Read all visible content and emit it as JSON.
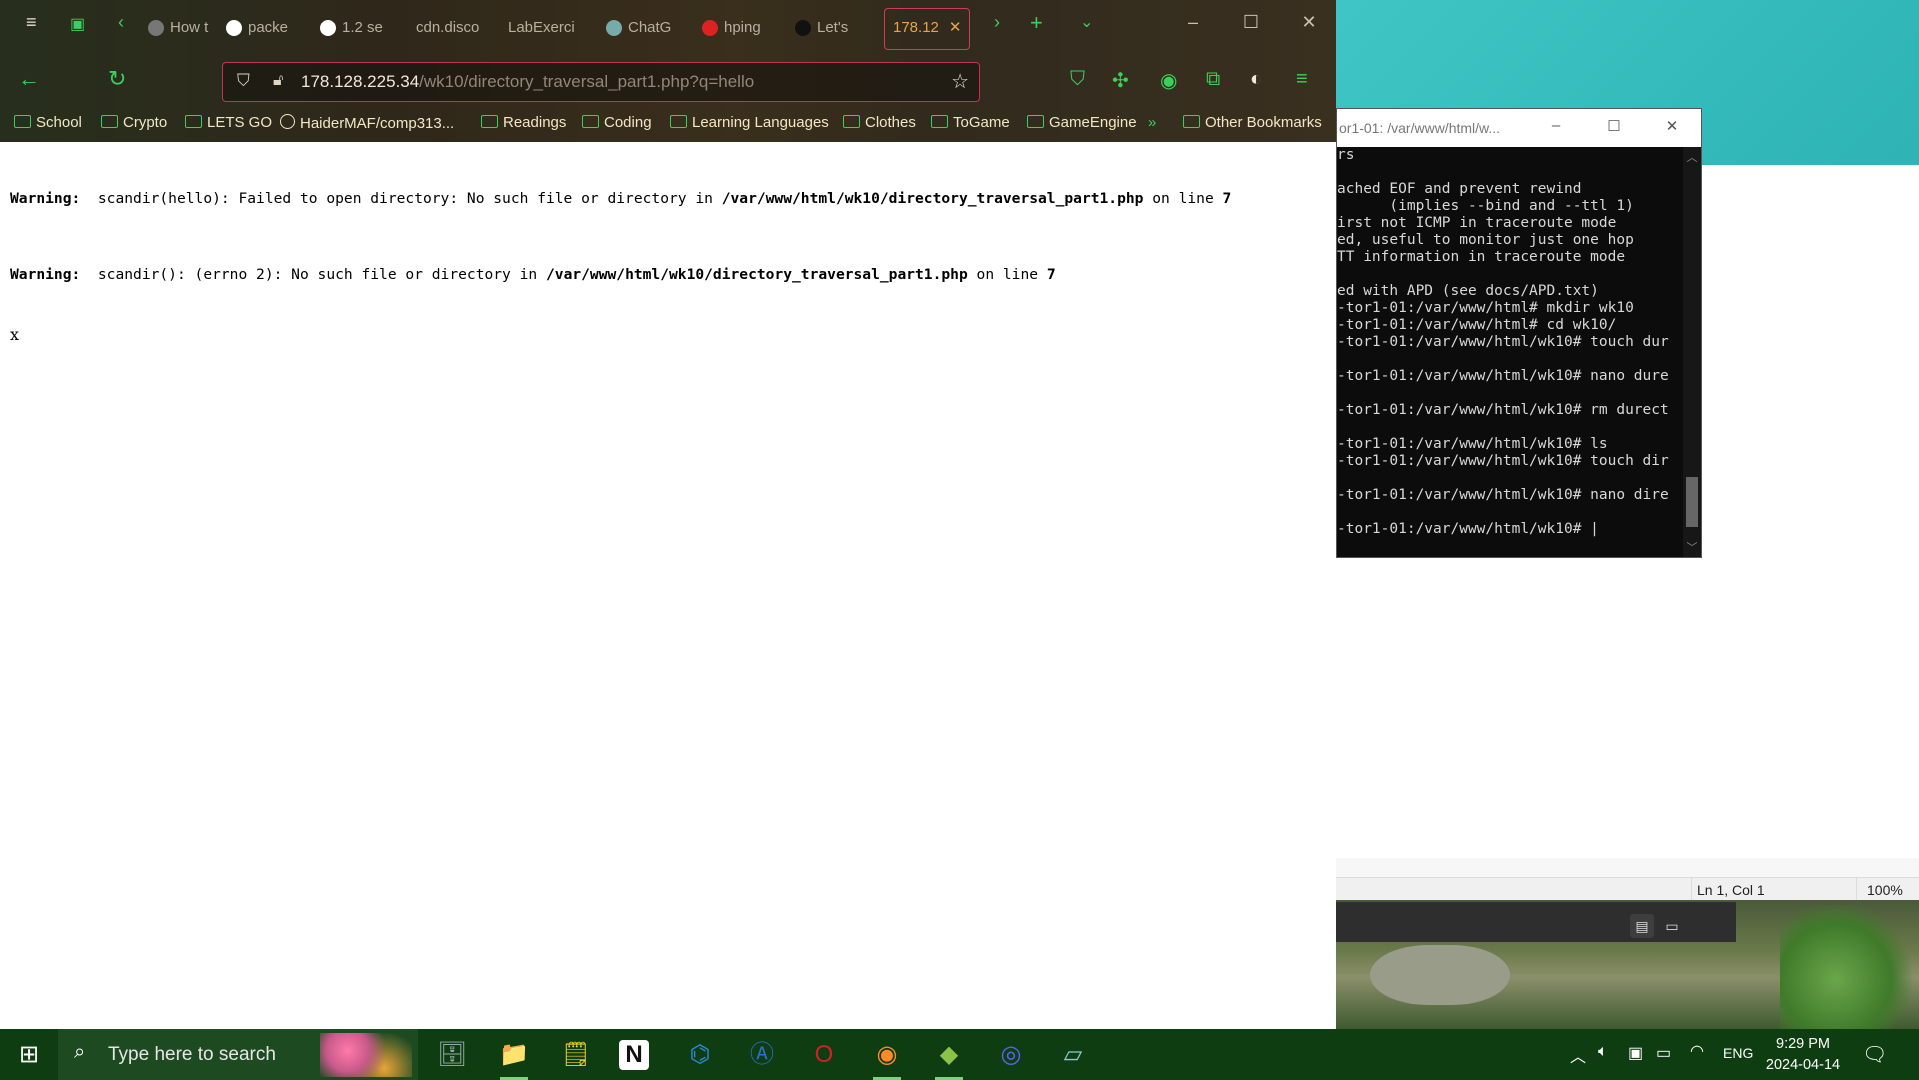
{
  "browser": {
    "tabs": [
      {
        "label": "How t",
        "fav": "#777"
      },
      {
        "label": "packe",
        "fav": "google"
      },
      {
        "label": "1.2 se",
        "fav": "google"
      },
      {
        "label": "cdn.disco",
        "fav": "none"
      },
      {
        "label": "LabExerci",
        "fav": "none"
      },
      {
        "label": "ChatG",
        "fav": "#7aa"
      },
      {
        "label": "hping",
        "fav": "#d22"
      },
      {
        "label": "Let's",
        "fav": "#111"
      },
      {
        "label": "178.12",
        "fav": "none",
        "active": true
      }
    ],
    "url_host": "178.128.225.34",
    "url_path": "/wk10/directory_traversal_part1.php?q=hello",
    "bookmarks": [
      "School",
      "Crypto",
      "LETS GO",
      "HaiderMAF/comp313...",
      "Readings",
      "Coding",
      "Learning Languages",
      "Clothes",
      "ToGame",
      "GameEngine"
    ],
    "other_bookmarks": "Other Bookmarks"
  },
  "page": {
    "warning1": {
      "label": "Warning",
      "text": "scandir(hello): Failed to open directory: No such file or directory in ",
      "file": "/var/www/html/wk10/directory_traversal_part1.php",
      "on_line": " on line ",
      "line": "7"
    },
    "warning2": {
      "label": "Warning",
      "text": "scandir(): (errno 2): No such file or directory in ",
      "file": "/var/www/html/wk10/directory_traversal_part1.php",
      "on_line": " on line ",
      "line": "7"
    },
    "output": "x"
  },
  "terminal": {
    "title": "or1-01: /var/www/html/w...",
    "lines": [
      "rs",
      "",
      "ached EOF and prevent rewind",
      "      (implies --bind and --ttl 1)",
      "irst not ICMP in traceroute mode",
      "ed, useful to monitor just one hop",
      "TT information in traceroute mode",
      "",
      "ed with APD (see docs/APD.txt)",
      "-tor1-01:/var/www/html# mkdir wk10",
      "-tor1-01:/var/www/html# cd wk10/",
      "-tor1-01:/var/www/html/wk10# touch dur",
      "",
      "-tor1-01:/var/www/html/wk10# nano dure",
      "",
      "-tor1-01:/var/www/html/wk10# rm durect",
      "",
      "-tor1-01:/var/www/html/wk10# ls",
      "-tor1-01:/var/www/html/wk10# touch dir",
      "",
      "-tor1-01:/var/www/html/wk10# nano dire",
      "",
      "-tor1-01:/var/www/html/wk10# |"
    ]
  },
  "notepad": {
    "position": "Ln 1, Col 1",
    "zoom": "100%"
  },
  "taskbar": {
    "search_placeholder": "Type here to search",
    "language": "ENG",
    "time": "9:29 PM",
    "date": "2024-04-14",
    "apps": [
      {
        "name": "database-app",
        "glyph": "🗄"
      },
      {
        "name": "file-explorer",
        "glyph": "📁"
      },
      {
        "name": "sticky-notes",
        "glyph": "🗒"
      },
      {
        "name": "notion",
        "glyph": "N"
      },
      {
        "name": "vscode",
        "glyph": "⌬"
      },
      {
        "name": "app-store",
        "glyph": "Ⓐ"
      },
      {
        "name": "opera",
        "glyph": "O"
      },
      {
        "name": "firefox",
        "glyph": "◉"
      },
      {
        "name": "git-tool",
        "glyph": "◆"
      },
      {
        "name": "discord",
        "glyph": "◎"
      },
      {
        "name": "notepad",
        "glyph": "▱"
      }
    ]
  }
}
